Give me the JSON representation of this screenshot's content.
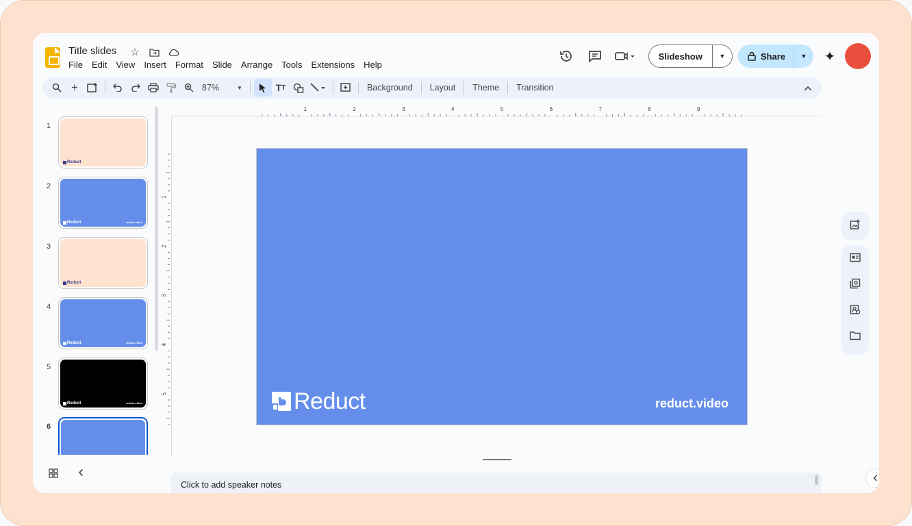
{
  "app": {
    "doc_title": "Title slides",
    "menu": [
      "File",
      "Edit",
      "View",
      "Insert",
      "Format",
      "Slide",
      "Arrange",
      "Tools",
      "Extensions",
      "Help"
    ]
  },
  "header": {
    "slideshow_label": "Slideshow",
    "share_label": "Share",
    "avatar_color": "#ea4e3d"
  },
  "toolbar": {
    "zoom": "87%",
    "background_label": "Background",
    "layout_label": "Layout",
    "theme_label": "Theme",
    "transition_label": "Transition"
  },
  "rulers": {
    "horizontal": [
      "1",
      "2",
      "3",
      "4",
      "5",
      "6",
      "7",
      "8",
      "9"
    ],
    "vertical": [
      "1",
      "2",
      "3",
      "4",
      "5"
    ]
  },
  "slides": [
    {
      "number": "1",
      "bg": "#fde3cf",
      "logo_dark": true,
      "show_url": false
    },
    {
      "number": "2",
      "bg": "#648eea",
      "logo_dark": false,
      "show_url": true
    },
    {
      "number": "3",
      "bg": "#fde3cf",
      "logo_dark": true,
      "show_url": false
    },
    {
      "number": "4",
      "bg": "#648eea",
      "logo_dark": false,
      "show_url": true
    },
    {
      "number": "5",
      "bg": "#000000",
      "logo_dark": false,
      "show_url": true
    },
    {
      "number": "6",
      "bg": "#648eea",
      "logo_dark": false,
      "show_url": false,
      "active": true
    }
  ],
  "thumb_logo_text": "Reduct",
  "thumb_url_text": "reduct.video",
  "current_slide": {
    "logo_text": "Reduct",
    "url_text": "reduct.video",
    "bg": "#648eea"
  },
  "notes_placeholder": "Click to add speaker notes"
}
